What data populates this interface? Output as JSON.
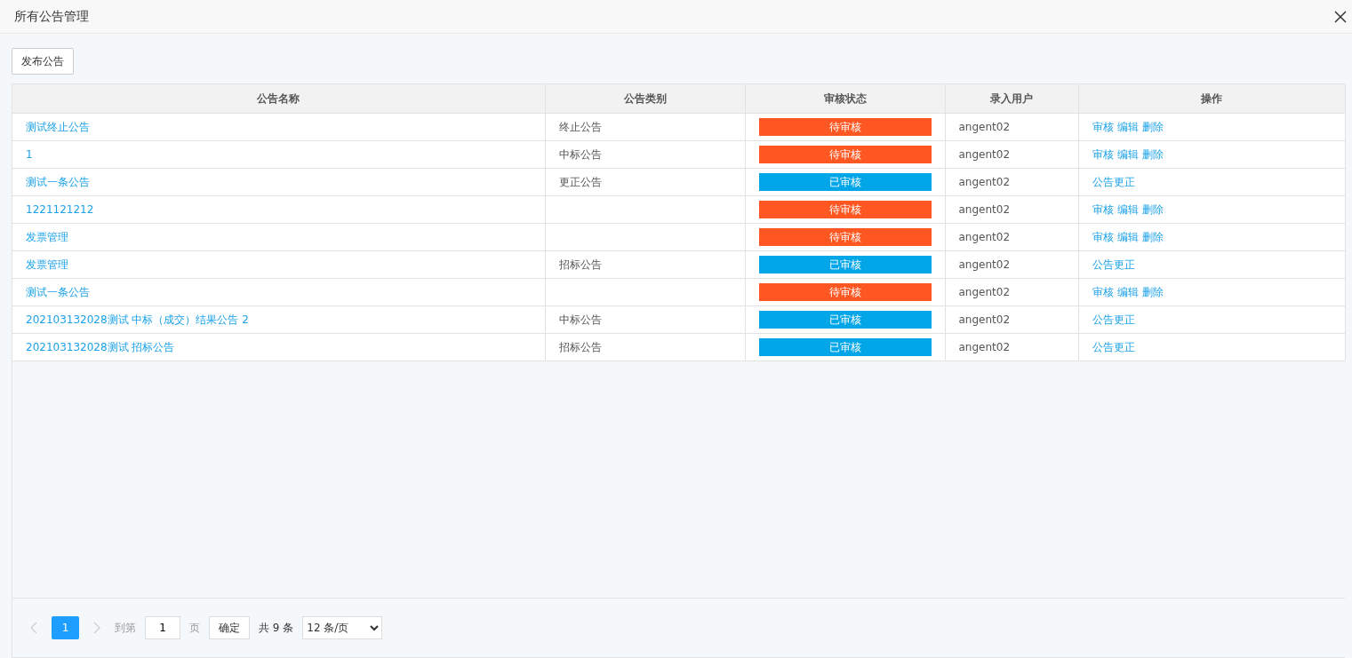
{
  "window": {
    "title": "所有公告管理"
  },
  "publish_button": "发布公告",
  "table": {
    "columns": [
      "公告名称",
      "公告类别",
      "审核状态",
      "录入用户",
      "操作"
    ],
    "rows": [
      {
        "name": "测试终止公告",
        "category": "终止公告",
        "status": {
          "text": "待审核",
          "kind": "pending"
        },
        "user": "angent02",
        "actions": [
          "审核",
          "编辑",
          "删除"
        ]
      },
      {
        "name": "1",
        "category": "中标公告",
        "status": {
          "text": "待审核",
          "kind": "pending"
        },
        "user": "angent02",
        "actions": [
          "审核",
          "编辑",
          "删除"
        ]
      },
      {
        "name": "测试一条公告",
        "category": "更正公告",
        "status": {
          "text": "已审核",
          "kind": "approved"
        },
        "user": "angent02",
        "actions": [
          "公告更正"
        ]
      },
      {
        "name": "1221121212",
        "status": {
          "text": "待审核",
          "kind": "pending"
        },
        "user": "angent02",
        "actions": [
          "审核",
          "编辑",
          "删除"
        ]
      },
      {
        "name": "发票管理",
        "status": {
          "text": "待审核",
          "kind": "pending"
        },
        "user": "angent02",
        "actions": [
          "审核",
          "编辑",
          "删除"
        ]
      },
      {
        "name": "发票管理",
        "category": "招标公告",
        "status": {
          "text": "已审核",
          "kind": "approved"
        },
        "user": "angent02",
        "actions": [
          "公告更正"
        ]
      },
      {
        "name": "测试一条公告",
        "status": {
          "text": "待审核",
          "kind": "pending"
        },
        "user": "angent02",
        "actions": [
          "审核",
          "编辑",
          "删除"
        ]
      },
      {
        "name": "202103132028测试 中标（成交）结果公告 2",
        "category": "中标公告",
        "status": {
          "text": "已审核",
          "kind": "approved"
        },
        "user": "angent02",
        "actions": [
          "公告更正"
        ]
      },
      {
        "name": "202103132028测试 招标公告",
        "category": "招标公告",
        "status": {
          "text": "已审核",
          "kind": "approved"
        },
        "user": "angent02",
        "actions": [
          "公告更正"
        ]
      }
    ]
  },
  "pagination": {
    "pages": [
      {
        "label": "1",
        "selected": true
      }
    ],
    "goto_label": "到第",
    "goto_value": "1",
    "page_unit": "页",
    "confirm": "确定",
    "total": "共 9 条",
    "page_size": "12 条/页"
  }
}
